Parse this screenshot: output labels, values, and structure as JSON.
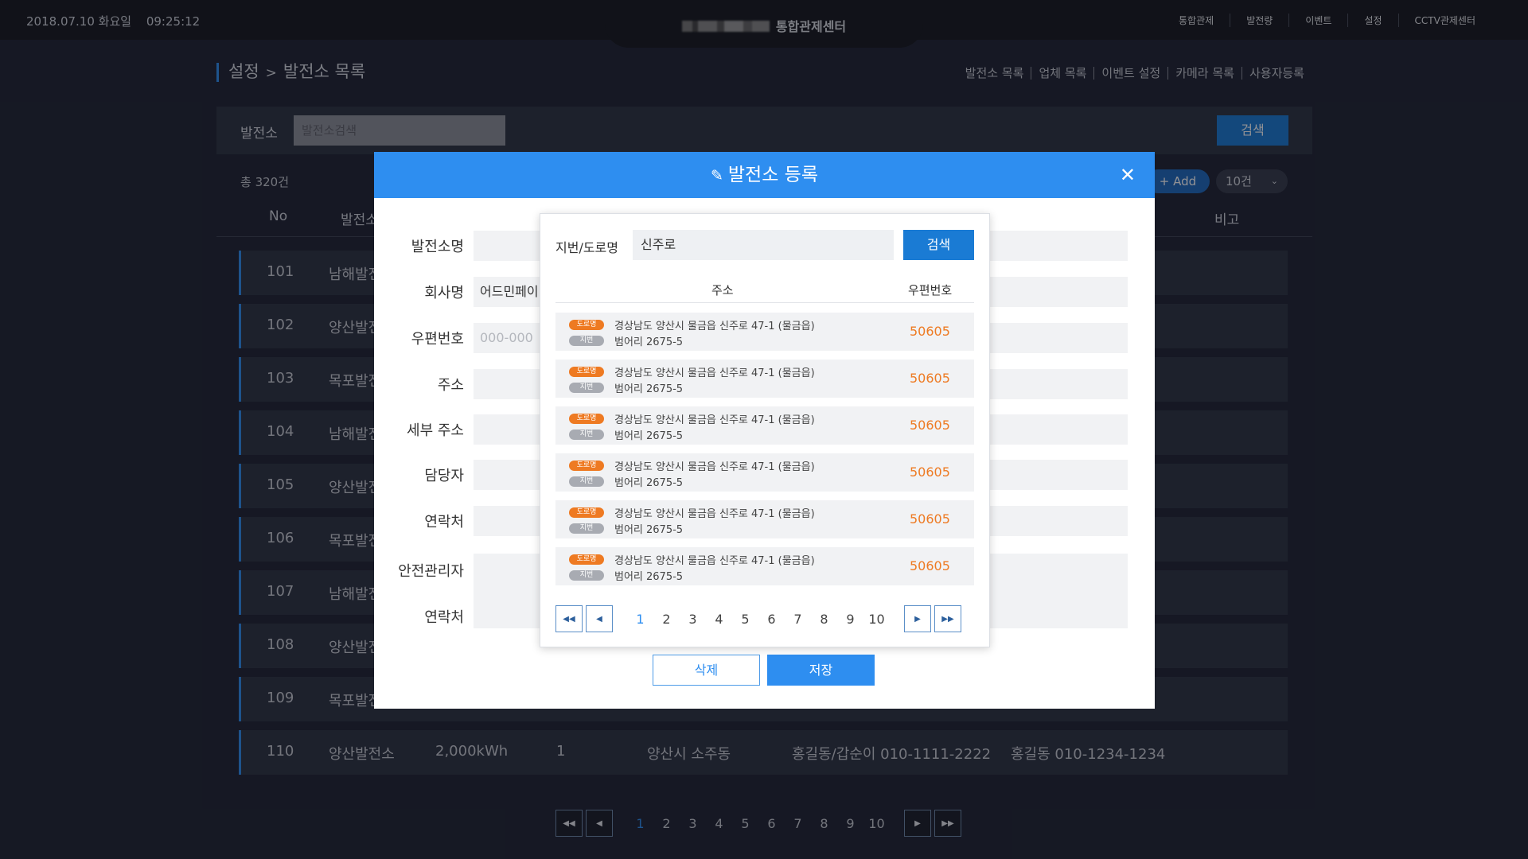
{
  "topbar": {
    "date": "2018.07.10 화요일",
    "time": "09:25:12",
    "title": "통합관제센터",
    "nav": [
      "통합관제",
      "발전량",
      "이벤트",
      "설정",
      "CCTV관제센터"
    ]
  },
  "breadcrumb": {
    "parent": "설정",
    "separator": ">",
    "current": "발전소 목록"
  },
  "subnav": [
    "발전소 목록",
    "업체 목록",
    "이벤트 설정",
    "카메라 목록",
    "사용자등록"
  ],
  "search": {
    "label": "발전소",
    "placeholder": "발전소검색",
    "button": "검색"
  },
  "list": {
    "total": "총 320건",
    "add_label": "+ Add",
    "page_size": "10건"
  },
  "table": {
    "headers": {
      "no": "No",
      "name": "발전소",
      "note": "비고"
    },
    "rows": [
      {
        "no": "101",
        "name": "남해발전"
      },
      {
        "no": "102",
        "name": "양산발전"
      },
      {
        "no": "103",
        "name": "목포발전"
      },
      {
        "no": "104",
        "name": "남해발전"
      },
      {
        "no": "105",
        "name": "양산발전"
      },
      {
        "no": "106",
        "name": "목포발전"
      },
      {
        "no": "107",
        "name": "남해발전"
      },
      {
        "no": "108",
        "name": "양산발전"
      },
      {
        "no": "109",
        "name": "목포발전"
      },
      {
        "no": "110",
        "name": "양산발전소",
        "capacity": "2,000kWh",
        "count": "1",
        "location": "양산시 소주동",
        "contact1": "홍길동/갑순이 010-1111-2222",
        "contact2": "홍길동 010-1234-1234"
      }
    ]
  },
  "pagination": {
    "pages": [
      "1",
      "2",
      "3",
      "4",
      "5",
      "6",
      "7",
      "8",
      "9",
      "10"
    ],
    "active": "1",
    "first_icon": "first-page-icon",
    "prev_icon": "prev-page-icon",
    "next_icon": "next-page-icon",
    "last_icon": "last-page-icon"
  },
  "modal": {
    "title": "발전소 등록",
    "fields": [
      {
        "label": "발전소명",
        "value": ""
      },
      {
        "label": "회사명",
        "value": "어드민페이"
      },
      {
        "label": "우편번호",
        "value": "",
        "placeholder": "000-000"
      },
      {
        "label": "주소",
        "value": ""
      },
      {
        "label": "세부 주소",
        "value": ""
      },
      {
        "label": "담당자",
        "value": ""
      },
      {
        "label": "연락처",
        "value": ""
      },
      {
        "label": "안전관리자",
        "value": ""
      },
      {
        "label": "연락처",
        "value": ""
      }
    ],
    "delete_label": "삭제",
    "save_label": "저장"
  },
  "address_popup": {
    "label": "지번/도로명",
    "query": "신주로",
    "search_button": "검색",
    "col_address": "주소",
    "col_zip": "우편번호",
    "results": [
      {
        "road_tag": "도로명",
        "road": "경상남도 양산시 물금읍 신주로 47-1 (물금읍)",
        "lot_tag": "지번",
        "lot": "범어리 2675-5",
        "zip": "50605"
      },
      {
        "road_tag": "도로명",
        "road": "경상남도 양산시 물금읍 신주로 47-1 (물금읍)",
        "lot_tag": "지번",
        "lot": "범어리 2675-5",
        "zip": "50605"
      },
      {
        "road_tag": "도로명",
        "road": "경상남도 양산시 물금읍 신주로 47-1 (물금읍)",
        "lot_tag": "지번",
        "lot": "범어리 2675-5",
        "zip": "50605"
      },
      {
        "road_tag": "도로명",
        "road": "경상남도 양산시 물금읍 신주로 47-1 (물금읍)",
        "lot_tag": "지번",
        "lot": "범어리 2675-5",
        "zip": "50605"
      },
      {
        "road_tag": "도로명",
        "road": "경상남도 양산시 물금읍 신주로 47-1 (물금읍)",
        "lot_tag": "지번",
        "lot": "범어리 2675-5",
        "zip": "50605"
      },
      {
        "road_tag": "도로명",
        "road": "경상남도 양산시 물금읍 신주로 47-1 (물금읍)",
        "lot_tag": "지번",
        "lot": "범어리 2675-5",
        "zip": "50605"
      }
    ],
    "pages": [
      "1",
      "2",
      "3",
      "4",
      "5",
      "6",
      "7",
      "8",
      "9",
      "10"
    ],
    "active": "1"
  },
  "colors": {
    "accent": "#2e8ef0",
    "background": "#1f2433",
    "panel": "#2d3343",
    "zip": "#ee7a22"
  }
}
